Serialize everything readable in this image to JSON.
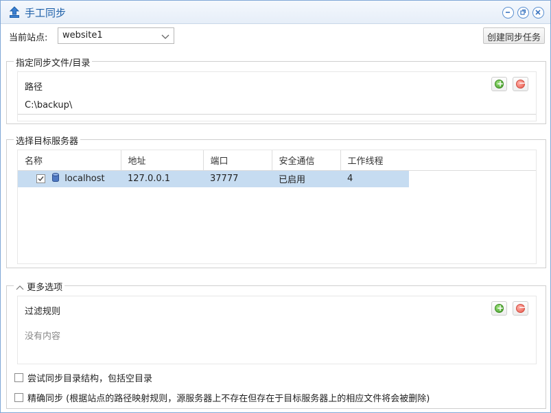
{
  "window": {
    "title": "手工同步"
  },
  "site": {
    "label": "当前站点:",
    "value": "website1"
  },
  "toolbar": {
    "create_label": "创建同步任务"
  },
  "path_section": {
    "legend": "指定同步文件/目录",
    "header": "路径",
    "rows": [
      "C:\\backup\\"
    ]
  },
  "server_section": {
    "legend": "选择目标服务器",
    "columns": [
      "名称",
      "地址",
      "端口",
      "安全通信",
      "工作线程"
    ],
    "rows": [
      {
        "checked": true,
        "name": "localhost",
        "address": "127.0.0.1",
        "port": "37777",
        "secure": "已启用",
        "threads": "4"
      }
    ]
  },
  "more_section": {
    "legend": "更多选项",
    "filter_header": "过滤规则",
    "filter_empty": "没有内容",
    "option1": "尝试同步目录结构，包括空目录",
    "option2": "精确同步 (根据站点的路径映射规则，源服务器上不存在但存在于目标服务器上的相应文件将会被删除)"
  },
  "colors": {
    "accent": "#1d5fa8",
    "selected_row": "#c6dcf1"
  }
}
